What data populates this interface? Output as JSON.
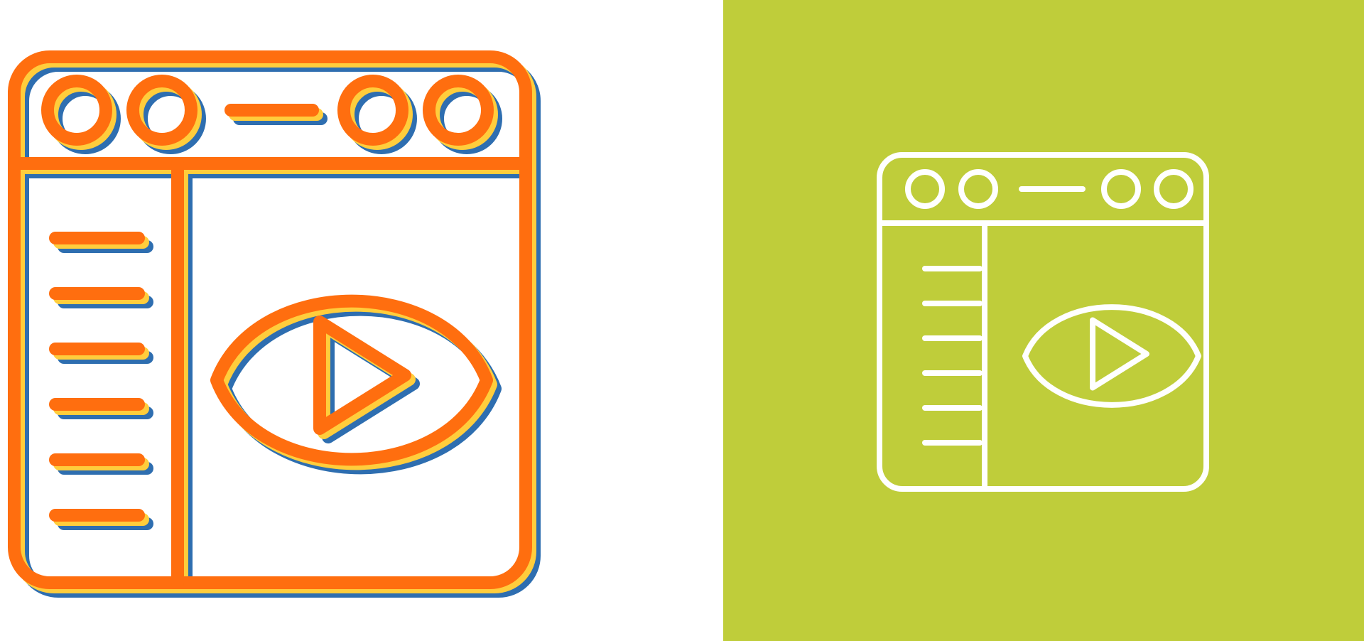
{
  "panels": [
    {
      "name": "color-variant",
      "background": "#ffffff",
      "style": "layered-line",
      "colors": {
        "primary": "#ff6e0f",
        "accent": "#ffcd3c",
        "shadow": "#2e6eb0"
      }
    },
    {
      "name": "white-line-variant",
      "background": "#bfcd3a",
      "style": "line",
      "colors": {
        "stroke": "#ffffff"
      }
    }
  ],
  "icon": {
    "name": "video-monitoring-browser-icon",
    "parts": [
      "browser-window-icon",
      "title-bar-dots",
      "sidebar-lines",
      "eye-icon",
      "play-icon"
    ],
    "sidebar_line_count": 6,
    "title_bar_dot_count": 4
  }
}
